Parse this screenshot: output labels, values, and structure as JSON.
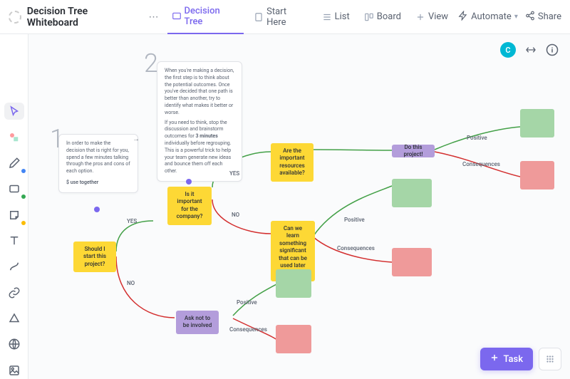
{
  "header": {
    "title": "Decision Tree Whiteboard",
    "tabs": [
      {
        "label": "Decision Tree"
      },
      {
        "label": "Start Here"
      },
      {
        "label": "List"
      },
      {
        "label": "Board"
      },
      {
        "label": "View"
      }
    ],
    "automate": "Automate",
    "share": "Share"
  },
  "subheader": {
    "avatar_initial": "C"
  },
  "notes": {
    "num1": "1",
    "num2": "2",
    "note1_body": "In order to make the decision that is right for you, spend a few minutes talking through the pros and cons of each option.",
    "note1_footer": "$ use together",
    "note2_p1": "When you're making a decision, the first step is to think about the potential outcomes. Once you've decided that one path is better than another, try to identify what makes it better or worse.",
    "note2_p2a": "If you need to think, stop the discussion and brainstorm outcomes for ",
    "note2_bold": "3 minutes",
    "note2_p2b": " individually before regrouping. This is a powerful trick to help your team generate new ideas and bounce them off each other."
  },
  "labels": {
    "yes1": "YES",
    "no1": "NO",
    "yes2": "YES",
    "no2": "NO",
    "pos1": "Positive",
    "con1": "Consequences",
    "pos2": "Positive",
    "con2": "Consequences",
    "pos3": "Positive",
    "con3": "Consequences"
  },
  "nodes": {
    "n1": "Should I start this project?",
    "n2": "Is it important for the company?",
    "n3": "Are the important resources available?",
    "n4": "Can we learn something significant that can be used later on?",
    "n5": "Ask not to be involved",
    "n6": "Do this project!"
  },
  "footer": {
    "task": "Task"
  },
  "colors": {
    "yellow": "#fdd835",
    "purple": "#b39ddb",
    "green": "#a5d6a7",
    "red": "#ef9a9a",
    "accent": "#7b68ee",
    "cyan": "#00b8d4",
    "edge_green": "#43a047",
    "edge_red": "#d32f2f"
  }
}
